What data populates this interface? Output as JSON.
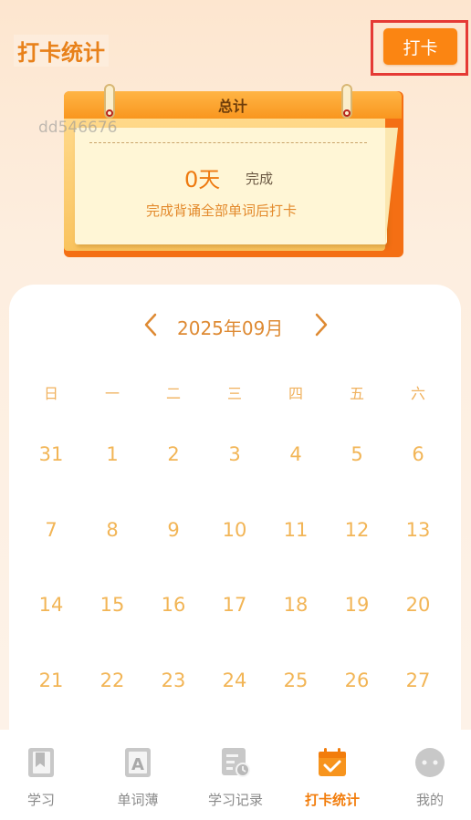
{
  "header": {
    "title": "打卡统计",
    "checkin_button": "打卡"
  },
  "watermark": "dd546676",
  "summary": {
    "title": "总计",
    "days_value": "0天",
    "days_status": "完成",
    "hint": "完成背诵全部单词后打卡"
  },
  "calendar": {
    "month_label": "2025年09月",
    "weekdays": [
      "日",
      "一",
      "二",
      "三",
      "四",
      "五",
      "六"
    ],
    "rows": [
      [
        "31",
        "1",
        "2",
        "3",
        "4",
        "5",
        "6"
      ],
      [
        "7",
        "8",
        "9",
        "10",
        "11",
        "12",
        "13"
      ],
      [
        "14",
        "15",
        "16",
        "17",
        "18",
        "19",
        "20"
      ],
      [
        "21",
        "22",
        "23",
        "24",
        "25",
        "26",
        "27"
      ]
    ]
  },
  "tabs": [
    {
      "label": "学习",
      "icon": "book-icon",
      "active": false
    },
    {
      "label": "单词薄",
      "icon": "letter-a-icon",
      "active": false
    },
    {
      "label": "学习记录",
      "icon": "history-icon",
      "active": false
    },
    {
      "label": "打卡统计",
      "icon": "calendar-check-icon",
      "active": true
    },
    {
      "label": "我的",
      "icon": "profile-icon",
      "active": false
    }
  ],
  "colors": {
    "accent": "#fb8512",
    "highlight_frame": "#e53a35",
    "day_text": "#f2b556",
    "inactive_tab": "#8a8a8a"
  }
}
